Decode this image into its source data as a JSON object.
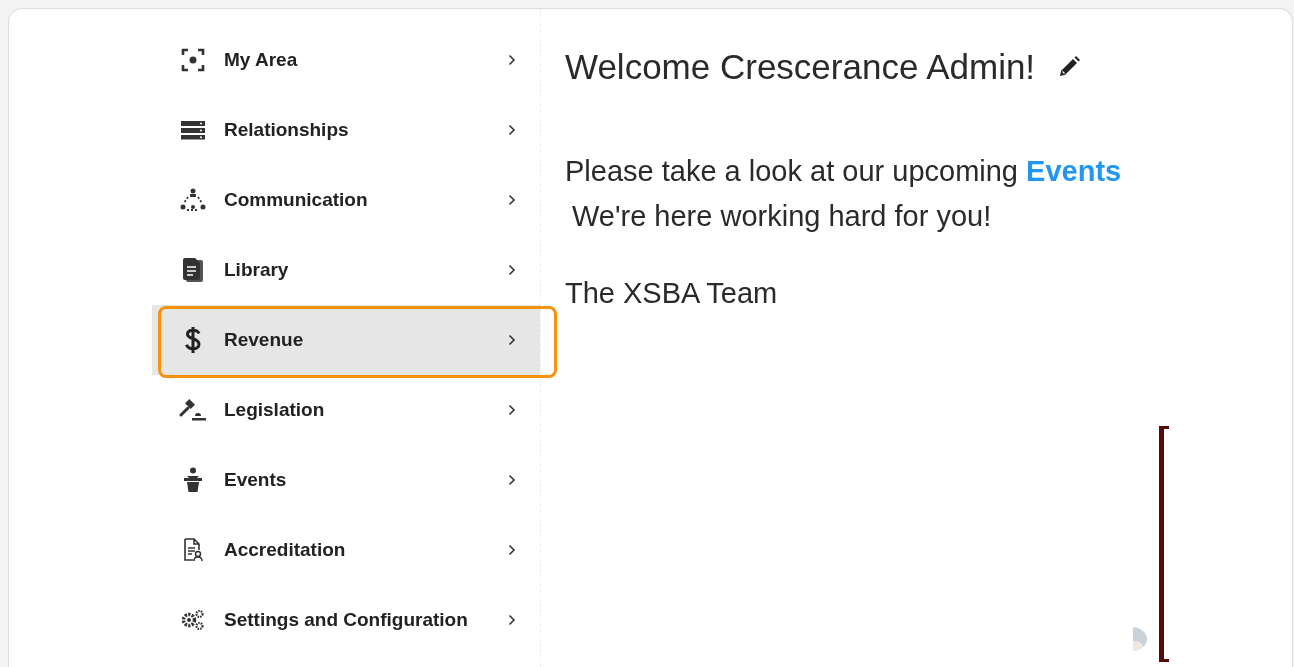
{
  "sidebar": {
    "items": [
      {
        "label": "My Area",
        "selected": false,
        "highlighted": false
      },
      {
        "label": "Relationships",
        "selected": false,
        "highlighted": false
      },
      {
        "label": "Communication",
        "selected": false,
        "highlighted": false
      },
      {
        "label": "Library",
        "selected": false,
        "highlighted": false
      },
      {
        "label": "Revenue",
        "selected": true,
        "highlighted": true
      },
      {
        "label": "Legislation",
        "selected": false,
        "highlighted": false
      },
      {
        "label": "Events",
        "selected": false,
        "highlighted": false
      },
      {
        "label": "Accreditation",
        "selected": false,
        "highlighted": false
      },
      {
        "label": "Settings and Configuration",
        "selected": false,
        "highlighted": false
      }
    ]
  },
  "content": {
    "title": "Welcome Crescerance Admin!",
    "message_before": "Please take a look at our upcoming",
    "message_link": "Events",
    "message_second_line": "We're here working hard for you!",
    "signature": "The XSBA Team"
  }
}
